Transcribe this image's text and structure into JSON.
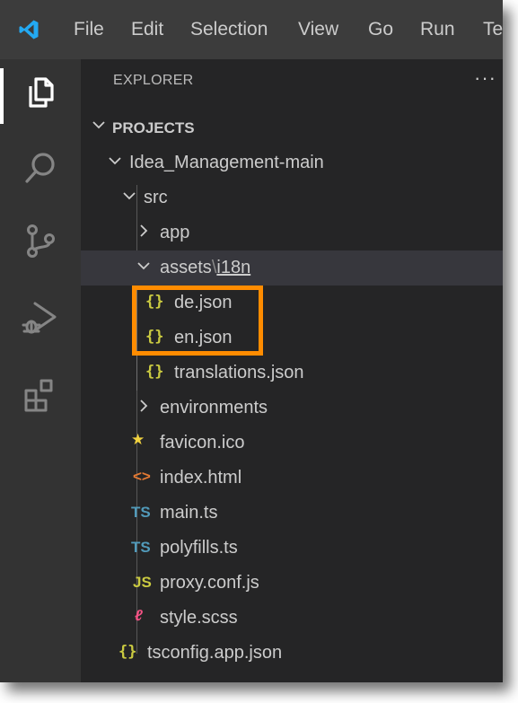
{
  "menubar": {
    "logo": "vscode-logo",
    "items": [
      "File",
      "Edit",
      "Selection",
      "View",
      "Go",
      "Run",
      "Term"
    ]
  },
  "activitybar": {
    "icons": [
      "explorer-icon",
      "search-icon",
      "source-control-icon",
      "run-debug-icon",
      "extensions-icon"
    ],
    "active": "explorer-icon"
  },
  "sidebar": {
    "title": "EXPLORER",
    "more_actions": "···",
    "section": "PROJECTS",
    "tree": {
      "root": "Idea_Management-main",
      "src": "src",
      "app": "app",
      "assets": "assets",
      "assets_sep": "\\",
      "i18n": "i18n",
      "de_json": "de.json",
      "en_json": "en.json",
      "translations_json": "translations.json",
      "environments": "environments",
      "favicon": "favicon.ico",
      "index_html": "index.html",
      "main_ts": "main.ts",
      "polyfills_ts": "polyfills.ts",
      "proxy_conf_js": "proxy.conf.js",
      "style_scss": "style.scss",
      "tsconfig_app_json": "tsconfig.app.json"
    },
    "icon_glyphs": {
      "json": "{}",
      "ts": "TS",
      "js": "JS"
    }
  },
  "colors": {
    "highlight": "#ff8c00",
    "json": "#cbcb41",
    "ts": "#519aba",
    "html": "#e37933",
    "scss": "#f55385"
  }
}
